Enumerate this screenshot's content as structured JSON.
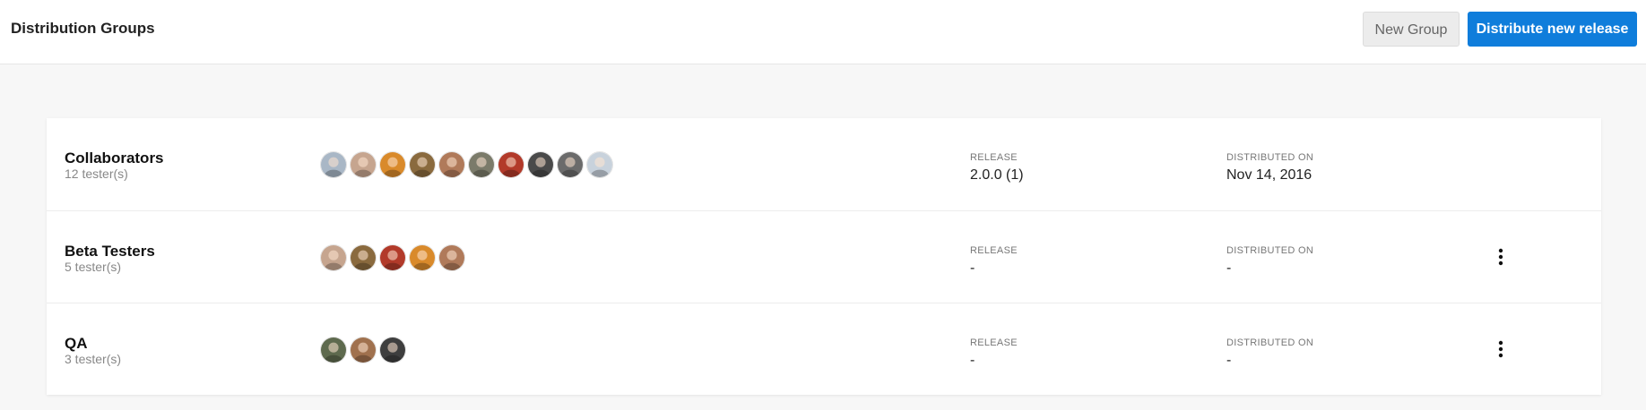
{
  "header": {
    "title": "Distribution Groups",
    "new_group_label": "New Group",
    "distribute_label": "Distribute new release"
  },
  "colors": {
    "primary": "#0f7ddb",
    "background": "#f7f7f7",
    "card": "#ffffff"
  },
  "groups": [
    {
      "name": "Collaborators",
      "testers": "12 tester(s)",
      "avatars": [
        "#a9b7c6",
        "#c6a58f",
        "#d98a2b",
        "#8a6a3e",
        "#b07a5a",
        "#7b7b6a",
        "#b23a2a",
        "#4a4a4a",
        "#6b6b6b",
        "#c8d2dc"
      ],
      "release_label": "RELEASE",
      "release_value": "2.0.0 (1)",
      "distributed_label": "DISTRIBUTED ON",
      "distributed_value": "Nov 14, 2016",
      "has_menu": false
    },
    {
      "name": "Beta Testers",
      "testers": "5 tester(s)",
      "avatars": [
        "#c6a58f",
        "#8a6a3e",
        "#b23a2a",
        "#d98a2b",
        "#b07a5a"
      ],
      "release_label": "RELEASE",
      "release_value": "-",
      "distributed_label": "DISTRIBUTED ON",
      "distributed_value": "-",
      "has_menu": true
    },
    {
      "name": "QA",
      "testers": "3 tester(s)",
      "avatars": [
        "#5e6a4e",
        "#a0714e",
        "#3e3e3e"
      ],
      "release_label": "RELEASE",
      "release_value": "-",
      "distributed_label": "DISTRIBUTED ON",
      "distributed_value": "-",
      "has_menu": true
    }
  ]
}
